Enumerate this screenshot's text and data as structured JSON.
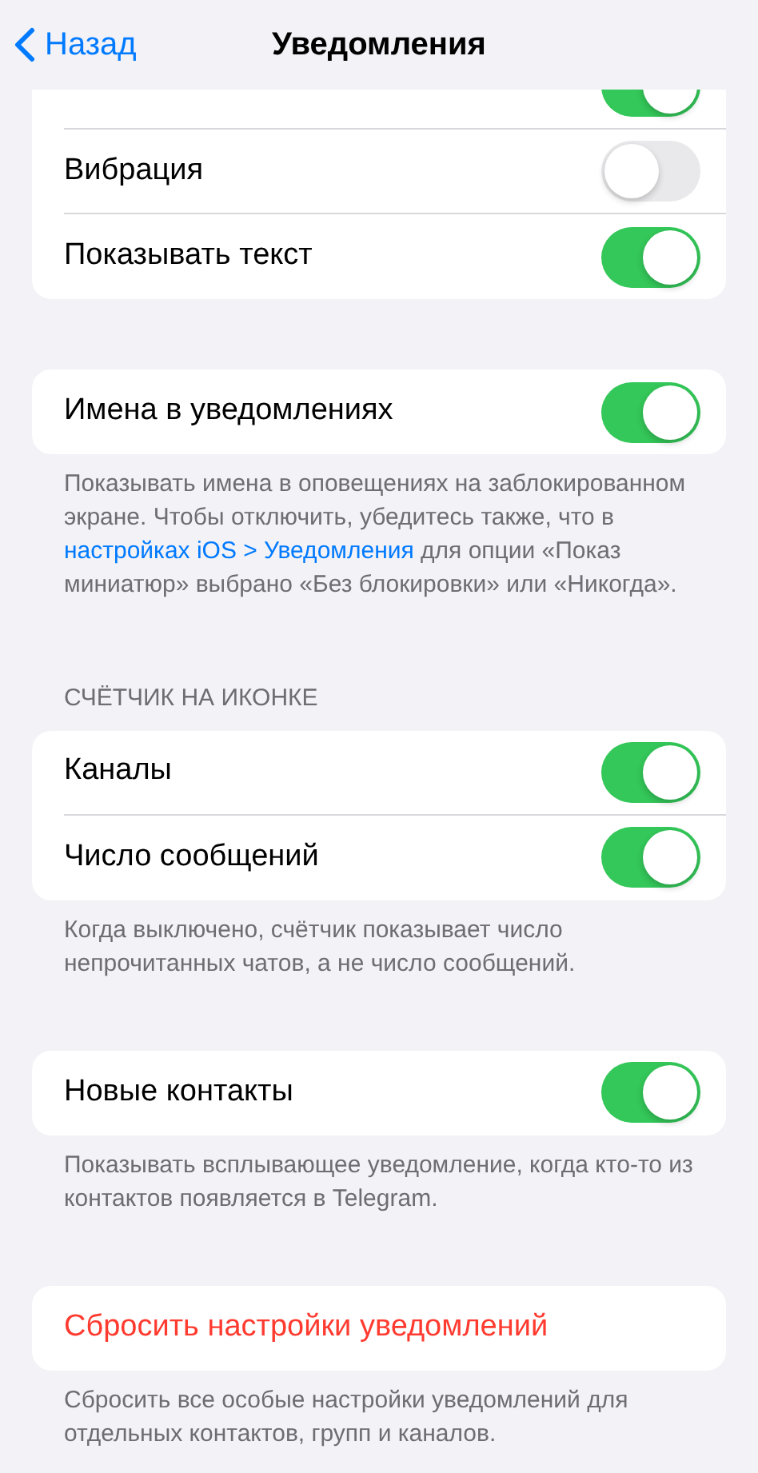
{
  "nav": {
    "back": "Назад",
    "title": "Уведомления"
  },
  "sections": [
    {
      "rows": [
        {
          "kind": "toggle",
          "on": true
        },
        {
          "kind": "toggle",
          "label": "Вибрация",
          "on": false
        },
        {
          "kind": "toggle",
          "label": "Показывать текст",
          "on": true
        }
      ]
    },
    {
      "rows": [
        {
          "kind": "toggle",
          "label": "Имена в уведомлениях",
          "on": true
        }
      ],
      "footer": {
        "before": "Показывать имена в оповещениях на заблокированном экране. Чтобы отключить, убедитесь также, что в ",
        "link": "настройках iOS > Уведомления",
        "after": " для опции «Показ миниатюр» выбрано «Без блокировки» или «Никогда»."
      }
    },
    {
      "header": "СЧЁТЧИК НА ИКОНКЕ",
      "rows": [
        {
          "kind": "toggle",
          "label": "Каналы",
          "on": true
        },
        {
          "kind": "toggle",
          "label": "Число сообщений",
          "on": true
        }
      ],
      "footer": {
        "before": "Когда выключено, счётчик показывает число непрочитанных чатов, а не число сообщений."
      }
    },
    {
      "rows": [
        {
          "kind": "toggle",
          "label": "Новые контакты",
          "on": true
        }
      ],
      "footer": {
        "before": "Показывать всплывающее уведомление, когда кто-то из контактов появляется в Telegram."
      }
    },
    {
      "rows": [
        {
          "kind": "destructive",
          "label": "Сбросить настройки уведомлений"
        }
      ],
      "footer": {
        "before": "Сбросить все особые настройки уведомлений для отдельных контактов, групп и каналов."
      }
    }
  ]
}
